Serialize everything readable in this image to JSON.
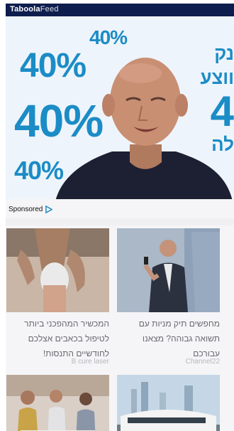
{
  "brand": {
    "name_bold": "Taboola",
    "name_light": "Feed"
  },
  "video": {
    "percent_labels": [
      "40%",
      "40%",
      "40%",
      "40%"
    ],
    "side_text_lines": [
      "נק",
      "ווצע",
      "4",
      "לה"
    ],
    "progress_fraction": 0.76
  },
  "sponsored_label": "Sponsored",
  "cards": [
    {
      "title": "המכשיר המהפכני ביותר לטיפול בכאבים אצלכם לחודשיים התנסות!",
      "source": "B cure laser"
    },
    {
      "title": "מחפשים תיק מניות עם תשואה גבוהה? מצאנו עבורכם",
      "source": "Channel22"
    }
  ],
  "colors": {
    "header_bg": "#0d1d4d",
    "accent_blue": "#1b8cc6",
    "progress": "#16398a"
  },
  "icons": {
    "sponsored_icon": "play-triangle-outline-icon"
  }
}
